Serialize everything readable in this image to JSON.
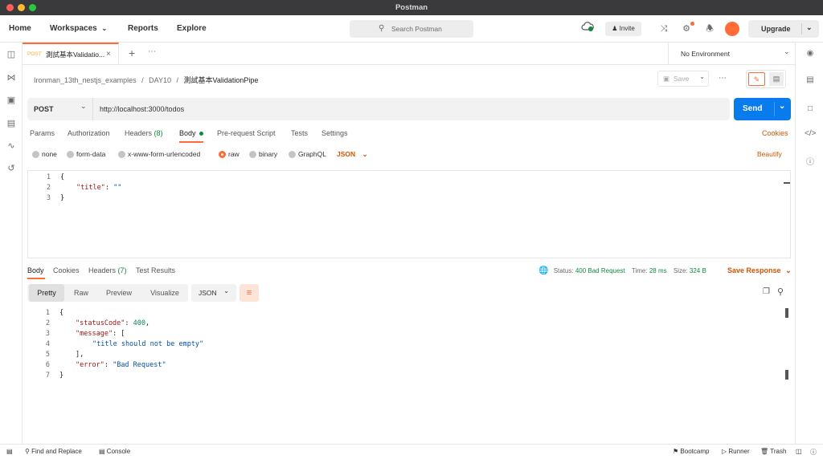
{
  "window": {
    "title": "Postman"
  },
  "nav": {
    "home": "Home",
    "workspaces": "Workspaces",
    "reports": "Reports",
    "explore": "Explore",
    "search_placeholder": "Search Postman",
    "invite": "Invite",
    "upgrade": "Upgrade"
  },
  "tab": {
    "method": "POST",
    "name": "測試基本Validatio...",
    "environment": "No Environment"
  },
  "breadcrumb": {
    "collection": "Ironman_13th_nestjs_examples",
    "folder": "DAY10",
    "request": "測試基本ValidationPipe",
    "save": "Save"
  },
  "request": {
    "method": "POST",
    "url": "http://localhost:3000/todos",
    "send": "Send",
    "tabs": {
      "params": "Params",
      "authorization": "Authorization",
      "headers": "Headers",
      "headers_count": "(8)",
      "body": "Body",
      "prerequest": "Pre-request Script",
      "tests": "Tests",
      "settings": "Settings",
      "cookies": "Cookies"
    },
    "body_types": {
      "none": "none",
      "form_data": "form-data",
      "urlencoded": "x-www-form-urlencoded",
      "raw": "raw",
      "binary": "binary",
      "graphql": "GraphQL",
      "format": "JSON",
      "beautify": "Beautify"
    },
    "body_lines": {
      "n1": "1",
      "n2": "2",
      "n3": "3",
      "l1": "{",
      "l2_key": "\"title\"",
      "l2_sep": ": ",
      "l2_val": "\"\"",
      "l3": "}"
    }
  },
  "response": {
    "tabs": {
      "body": "Body",
      "cookies": "Cookies",
      "headers": "Headers",
      "headers_count": "(7)",
      "tests": "Test Results"
    },
    "status_label": "Status:",
    "status_value": "400 Bad Request",
    "time_label": "Time:",
    "time_value": "28 ms",
    "size_label": "Size:",
    "size_value": "324 B",
    "save_response": "Save Response",
    "views": {
      "pretty": "Pretty",
      "raw": "Raw",
      "preview": "Preview",
      "visualize": "Visualize",
      "format": "JSON"
    },
    "body_lines": {
      "n1": "1",
      "n2": "2",
      "n3": "3",
      "n4": "4",
      "n5": "5",
      "n6": "6",
      "n7": "7",
      "l1": "{",
      "l2_key": "\"statusCode\"",
      "l2_val": "400",
      "l3_key": "\"message\"",
      "l3_rest": ": [",
      "l4_val": "\"title should not be empty\"",
      "l5": "],",
      "l6_key": "\"error\"",
      "l6_val": "\"Bad Request\"",
      "l7": "}"
    }
  },
  "statusbar": {
    "find_replace": "Find and Replace",
    "console": "Console",
    "bootcamp": "Bootcamp",
    "runner": "Runner",
    "trash": "Trash"
  },
  "colors": {
    "accent": "#ff6c37",
    "send": "#097bed",
    "status_ok_green": "#0f8a3c"
  }
}
